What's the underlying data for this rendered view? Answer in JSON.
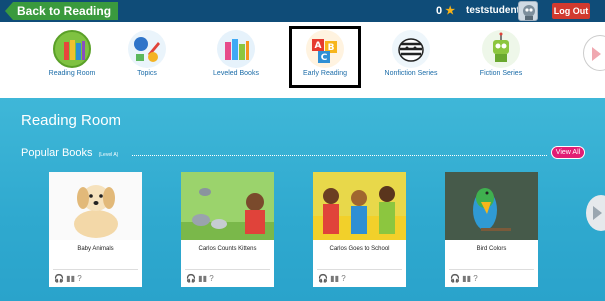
{
  "topbar": {
    "back_label": "Back to Reading",
    "points": "0",
    "star": "★",
    "username": "teststudent",
    "logout_label": "Log Out"
  },
  "nav": {
    "items": [
      {
        "label": "Reading Room"
      },
      {
        "label": "Topics"
      },
      {
        "label": "Leveled Books"
      },
      {
        "label": "Early Reading"
      },
      {
        "label": "Nonfiction Series"
      },
      {
        "label": "Fiction Series"
      }
    ],
    "selected_index": 3
  },
  "main": {
    "room_title": "Reading Room",
    "section_title": "Popular Books",
    "section_level": "(Level A)",
    "view_all_label": "View All",
    "books": [
      {
        "title": "Baby Animals"
      },
      {
        "title": "Carlos Counts Kittens"
      },
      {
        "title": "Carlos Goes to School"
      },
      {
        "title": "Bird Colors"
      }
    ],
    "book_icons": "🎧 ▮▮ ?"
  },
  "colors": {
    "topbar": "#0f4c78",
    "back_button": "#3a9a3e",
    "logout": "#d23a2f",
    "main_bg": "#35afd4",
    "view_all": "#e21d74",
    "nav_label": "#1b6ca8"
  }
}
